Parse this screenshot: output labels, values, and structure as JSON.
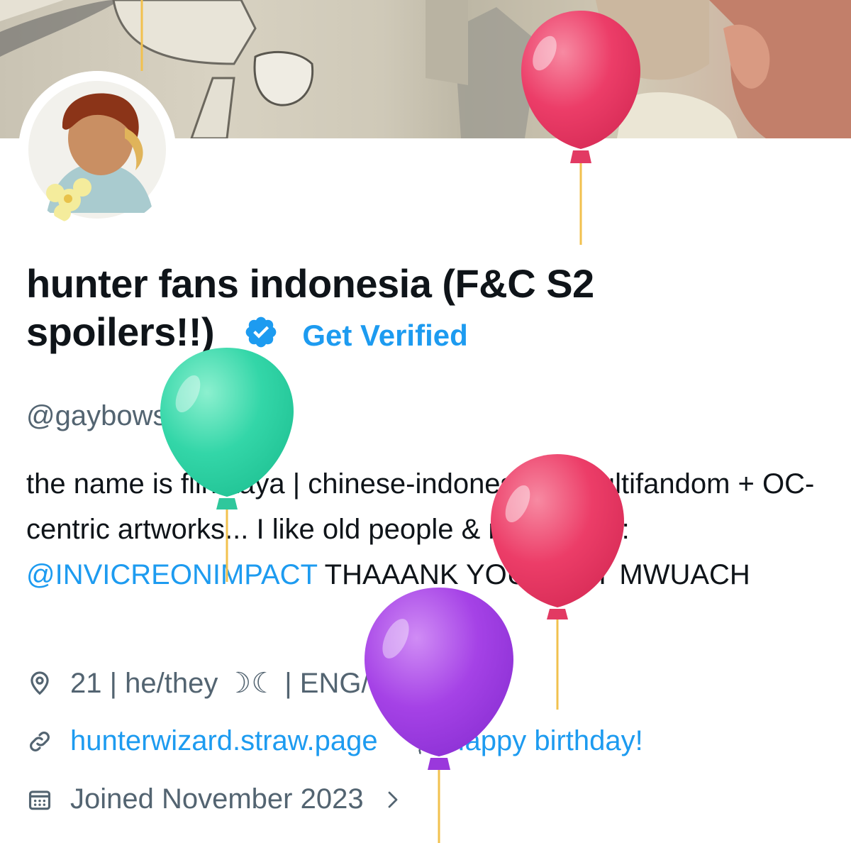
{
  "profile": {
    "display_name": "hunter fans indonesia (F&C S2 spoilers!!)",
    "verified_icon": "verified-badge-icon",
    "get_verified_label": "Get Verified",
    "handle": "@gaybowserz"
  },
  "bio": {
    "text_before_mention": "the name is flintkaya | chinese-indonesian | multifandom + OC-centric artworks... I like old people & mascs. | ic: ",
    "mention": "@INVICREONIMPACT",
    "text_after_mention": " THAAANK YOU VERY MWUACH"
  },
  "meta": {
    "location_icon": "location-pin-icon",
    "location": "21 | he/they ☽☾ | ENG/IDN ok",
    "link_icon": "link-icon",
    "website": "hunterwizard.straw.page",
    "birthday_icon": "balloon-icon",
    "birthday": "Happy birthday!",
    "calendar_icon": "calendar-icon",
    "joined": "Joined November 2023",
    "chevron_icon": "chevron-right-icon"
  },
  "colors": {
    "accent": "#1d9bf0",
    "secondary_text": "#536471",
    "primary_text": "#0f1419"
  },
  "decorations": {
    "balloon_colors": [
      "#ec3d68",
      "#33d6a8",
      "#ec3d68",
      "#a542e6"
    ]
  }
}
